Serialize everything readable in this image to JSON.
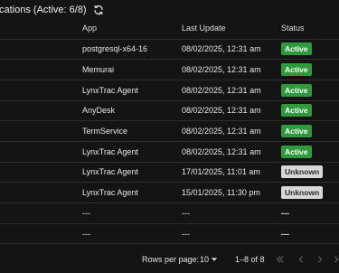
{
  "header": {
    "title": "cations  (Active: 6/8)",
    "refresh_icon": "refresh-icon"
  },
  "table": {
    "columns": [
      "App",
      "Last Update",
      "Status"
    ],
    "rows": [
      {
        "app": "postgresql-x64-16",
        "last_update": "08/02/2025, 12:31 am",
        "status": "Active"
      },
      {
        "app": "Memurai",
        "last_update": "08/02/2025, 12:31 am",
        "status": "Active"
      },
      {
        "app": "LynxTrac Agent",
        "last_update": "08/02/2025, 12:31 am",
        "status": "Active"
      },
      {
        "app": "AnyDesk",
        "last_update": "08/02/2025, 12:31 am",
        "status": "Active"
      },
      {
        "app": "TermService",
        "last_update": "08/02/2025, 12:31 am",
        "status": "Active"
      },
      {
        "app": "LynxTrac Agent",
        "last_update": "08/02/2025, 12:31 am",
        "status": "Active"
      },
      {
        "app": "LynxTrac Agent",
        "last_update": "17/01/2025, 11:01 am",
        "status": "Unknown"
      },
      {
        "app": "LynxTrac Agent",
        "last_update": "15/01/2025, 11:30 pm",
        "status": "Unknown"
      },
      {
        "app": "---",
        "last_update": "---",
        "status": "---"
      },
      {
        "app": "---",
        "last_update": "---",
        "status": "---"
      }
    ]
  },
  "footer": {
    "rows_per_page_label": "Rows per page:",
    "rows_per_page_value": "10",
    "range": "1–8 of 8"
  },
  "colors": {
    "active": "#2e9a3c",
    "unknown": "#d8d8d8",
    "background": "#141414"
  }
}
